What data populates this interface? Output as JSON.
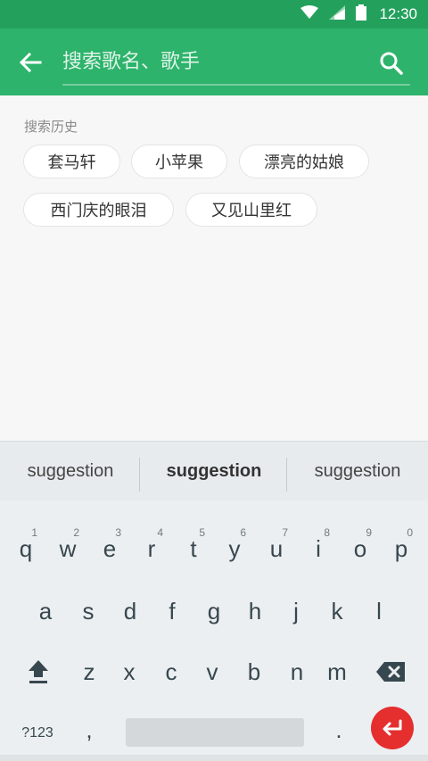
{
  "status_bar": {
    "time": "12:30"
  },
  "search": {
    "placeholder": "搜索歌名、歌手",
    "value": ""
  },
  "history": {
    "title": "搜索历史",
    "items": [
      "套马轩",
      "小苹果",
      "漂亮的姑娘",
      "西门庆的眼泪",
      "又见山里红"
    ]
  },
  "keyboard": {
    "suggestions": [
      "suggestion",
      "suggestion",
      "suggestion"
    ],
    "row1": [
      "q",
      "w",
      "e",
      "r",
      "t",
      "y",
      "u",
      "i",
      "o",
      "p"
    ],
    "row1_hints": [
      "1",
      "2",
      "3",
      "4",
      "5",
      "6",
      "7",
      "8",
      "9",
      "0"
    ],
    "row2": [
      "a",
      "s",
      "d",
      "f",
      "g",
      "h",
      "j",
      "k",
      "l"
    ],
    "row3": [
      "z",
      "x",
      "c",
      "v",
      "b",
      "n",
      "m"
    ],
    "symbols_label": "?123",
    "comma": ",",
    "period": "."
  },
  "colors": {
    "status_bar": "#23a15c",
    "app_bar": "#2db36b",
    "enter": "#e52e2e"
  }
}
